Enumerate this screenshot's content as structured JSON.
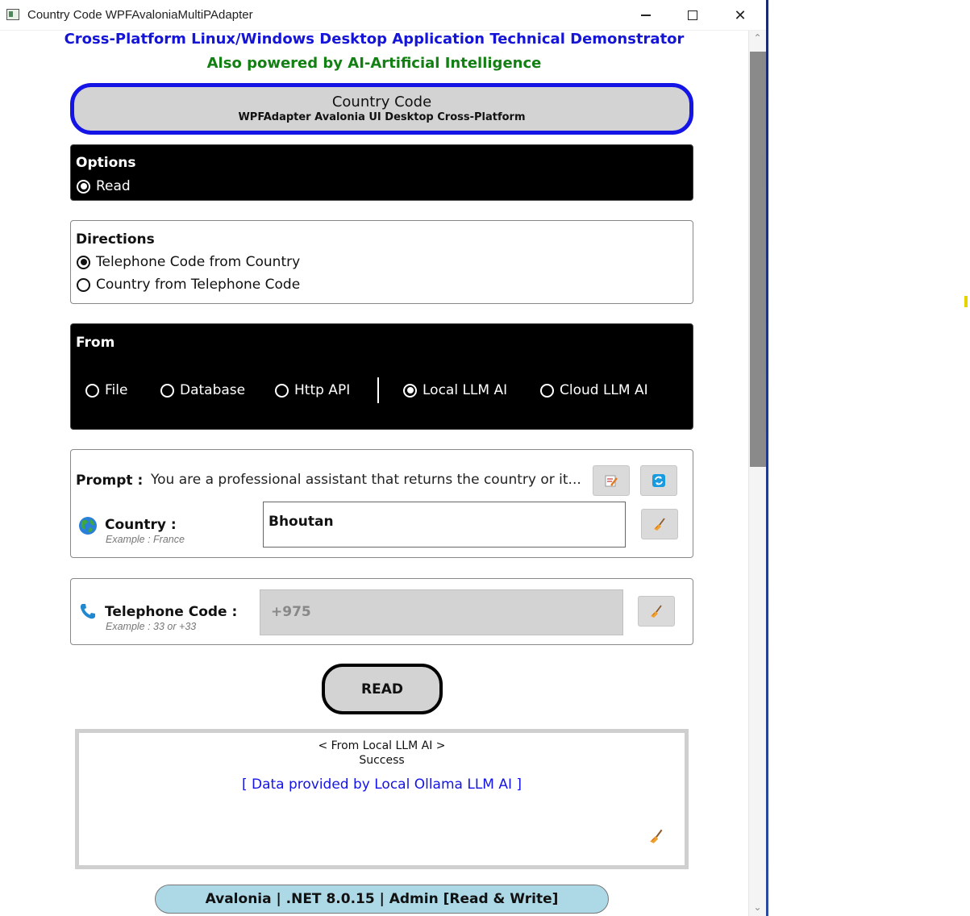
{
  "window": {
    "title": "Country Code WPFAvaloniaMultiPAdapter",
    "minimize_glyph": "—",
    "close_glyph": "✕"
  },
  "header": {
    "main": "Cross-Platform Linux/Windows Desktop Application Technical Demonstrator",
    "sub": "Also powered by AI-Artificial Intelligence",
    "main_color": "#1515d8",
    "sub_color": "#128012"
  },
  "banner": {
    "title": "Country Code",
    "subtitle": "WPFAdapter Avalonia UI Desktop Cross-Platform",
    "border_color": "#1414e6"
  },
  "options": {
    "label": "Options",
    "items": [
      {
        "label": "Read",
        "checked": true
      }
    ]
  },
  "directions": {
    "label": "Directions",
    "items": [
      {
        "label": "Telephone Code from Country",
        "checked": true
      },
      {
        "label": "Country from Telephone Code",
        "checked": false
      }
    ]
  },
  "from": {
    "label": "From",
    "items": [
      {
        "label": "File",
        "checked": false
      },
      {
        "label": "Database",
        "checked": false
      },
      {
        "label": "Http API",
        "checked": false
      },
      {
        "label": "Local LLM AI",
        "checked": true
      },
      {
        "label": "Cloud LLM AI",
        "checked": false
      }
    ]
  },
  "prompt": {
    "label": "Prompt :",
    "value": "You are a professional assistant that returns the country or it..."
  },
  "country": {
    "label": "Country :",
    "example": "Example : France",
    "value": "Bhoutan",
    "icon": "globe-icon"
  },
  "telephone": {
    "label": "Telephone Code :",
    "example": "Example : 33 or +33",
    "value": "+975",
    "icon": "telephone-icon"
  },
  "read_button": {
    "label": "READ"
  },
  "result": {
    "source": "< From Local LLM AI >",
    "status": "Success",
    "detail": "[ Data provided by Local Ollama LLM AI ]",
    "detail_color": "#1414e6"
  },
  "status_bar": {
    "text": "Avalonia | .NET 8.0.15 | Admin [Read & Write]",
    "color": "#add8e6"
  },
  "scrollbar": {
    "up_glyph": "⌃",
    "down_glyph": "⌄"
  }
}
